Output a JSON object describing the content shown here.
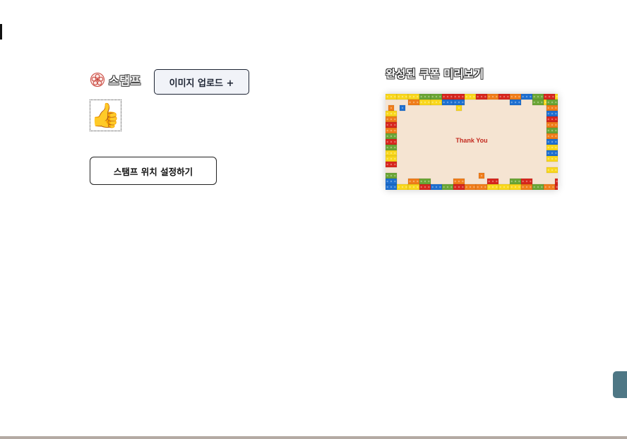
{
  "stamp": {
    "title": "스탬프",
    "upload_label": "이미지 업로드 +",
    "thumbnail_icon": "thumbs-up-icon",
    "thumbnail_glyph": "👍",
    "set_position_label": "스탬프 위치 설정하기"
  },
  "preview": {
    "title": "완성된 쿠폰 미리보기",
    "coupon_text": "Thank You",
    "border_style": "lego-bricks"
  },
  "colors": {
    "accent": "#4e7785",
    "coupon_bg": "#f5e4d2",
    "coupon_text": "#c32a1f",
    "brick_red": "#d7261e",
    "brick_orange": "#f07d1a",
    "brick_yellow": "#f9d71c",
    "brick_green": "#6aa535",
    "brick_blue": "#1e6fd0"
  }
}
